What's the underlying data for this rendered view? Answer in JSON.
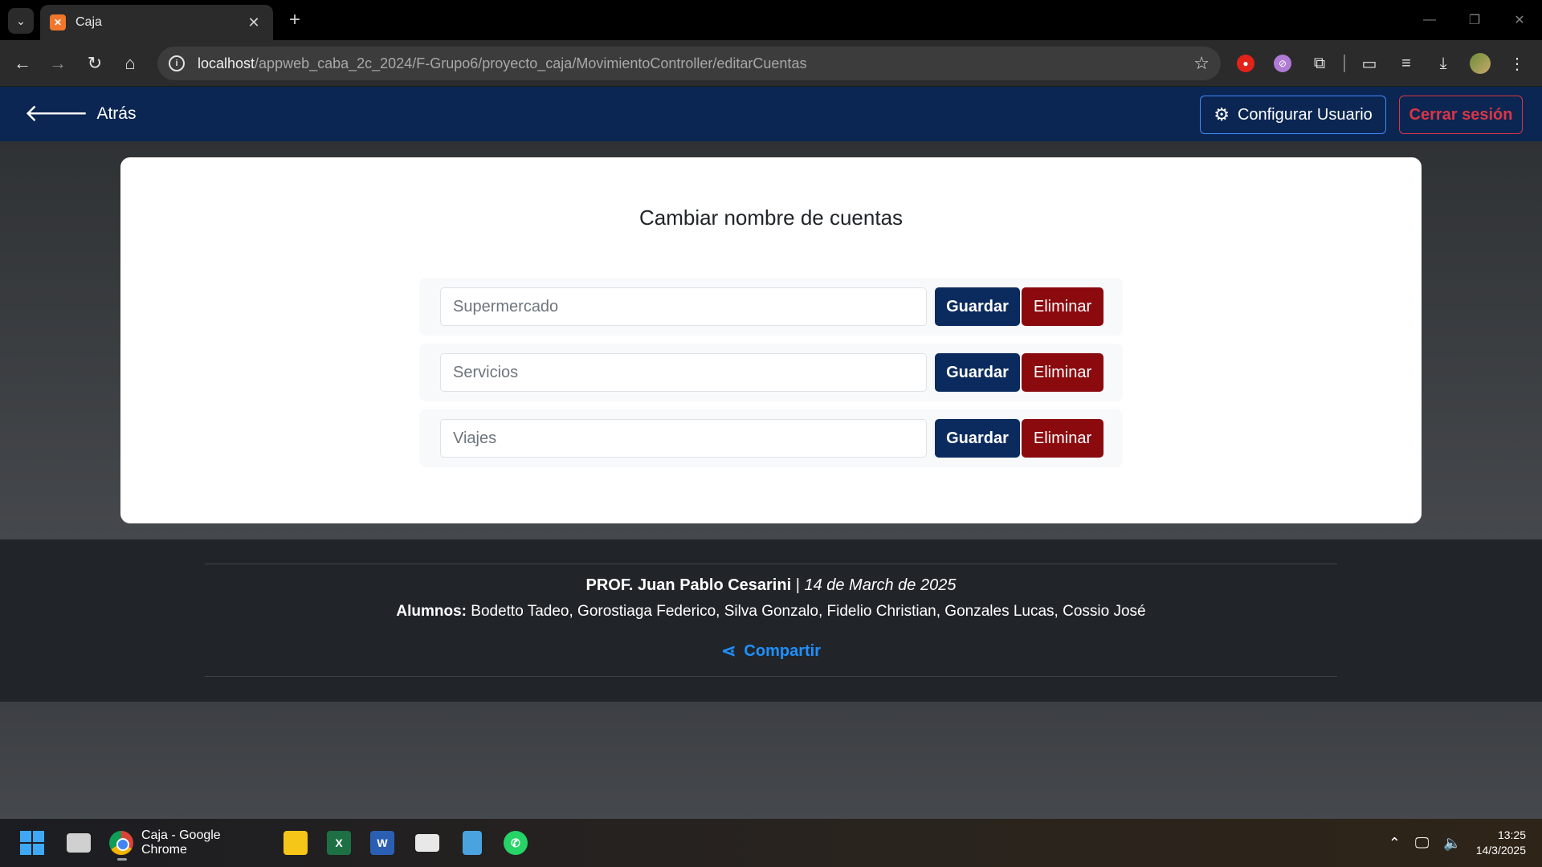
{
  "browser": {
    "tab_title": "Caja",
    "url_host": "localhost",
    "url_path": "/appweb_caba_2c_2024/F-Grupo6/proyecto_caja/MovimientoController/editarCuentas"
  },
  "navbar": {
    "back_label": "Atrás",
    "config_label": "Configurar Usuario",
    "logout_label": "Cerrar sesión"
  },
  "page": {
    "title": "Cambiar nombre de cuentas",
    "accounts": [
      {
        "name": "Supermercado",
        "save_label": "Guardar",
        "delete_label": "Eliminar"
      },
      {
        "name": "Servicios",
        "save_label": "Guardar",
        "delete_label": "Eliminar"
      },
      {
        "name": "Viajes",
        "save_label": "Guardar",
        "delete_label": "Eliminar"
      }
    ]
  },
  "footer": {
    "prof_label": "PROF. Juan Pablo Cesarini",
    "separator": " | ",
    "date": "14 de March de 2025",
    "alumnos_label": "Alumnos:",
    "alumnos": " Bodetto Tadeo, Gorostiaga Federico, Silva Gonzalo, Fidelio Christian, Gonzales Lucas, Cossio José",
    "share_label": "Compartir"
  },
  "taskbar": {
    "chrome_label": "Caja - Google Chrome",
    "time": "13:25",
    "date": "14/3/2025"
  },
  "colors": {
    "navbar": "#0b2652",
    "save_button": "#0b2b5e",
    "delete_button": "#8b0a0e",
    "logout": "#dc3545",
    "share": "#1e90ff"
  }
}
